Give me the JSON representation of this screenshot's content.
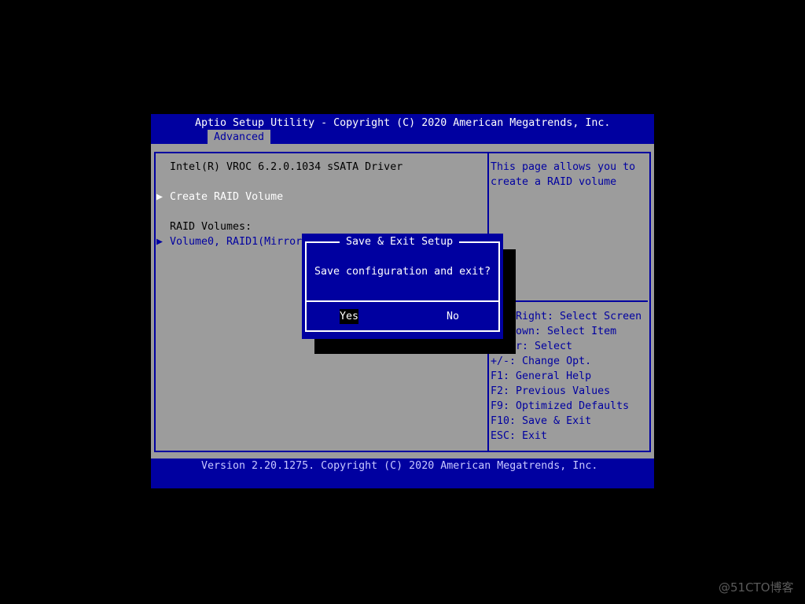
{
  "header": {
    "title": "Aptio Setup Utility - Copyright (C) 2020 American Megatrends, Inc.",
    "active_tab": "Advanced"
  },
  "main": {
    "driver": "Intel(R) VROC 6.2.0.1034 sSATA Driver",
    "create_raid": "Create RAID Volume",
    "raid_volumes_label": "RAID Volumes:",
    "volume0": "Volume0, RAID1(Mirror"
  },
  "help": {
    "description": [
      "This page allows you to",
      "create a RAID volume"
    ],
    "keys": [
      "/Right: Select Screen",
      "own: Select Item",
      "r: Select",
      "+/-: Change Opt.",
      "F1: General Help",
      "F2: Previous Values",
      "F9: Optimized Defaults",
      "F10: Save & Exit",
      "ESC: Exit"
    ]
  },
  "dialog": {
    "title": "Save & Exit Setup",
    "message": "Save configuration and exit?",
    "yes": "Yes",
    "no": "No",
    "selected": "Yes"
  },
  "footer": {
    "version": "Version 2.20.1275. Copyright (C) 2020 American Megatrends, Inc."
  },
  "watermark": "@51CTO博客",
  "colors": {
    "blue": "#0000a0",
    "gray": "#9c9c9c",
    "white": "#ffffff",
    "black": "#000000"
  }
}
